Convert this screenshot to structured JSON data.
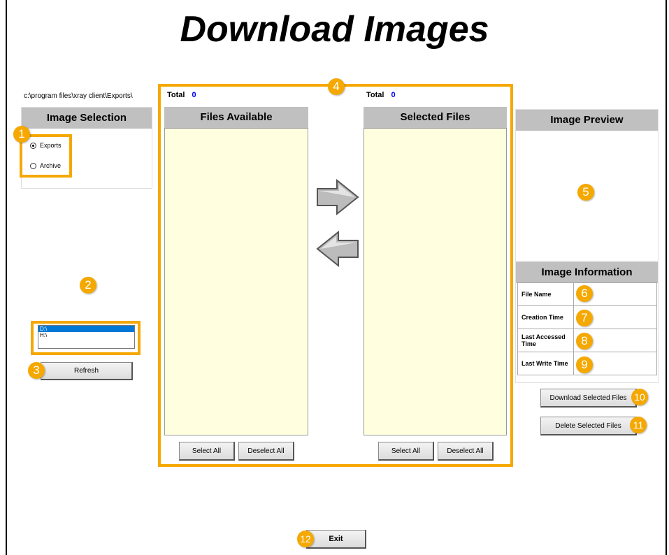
{
  "title": "Download Images",
  "path": "c:\\program files\\xray client\\Exports\\",
  "image_selection": {
    "header": "Image Selection",
    "options": [
      {
        "label": "Exports",
        "selected": true
      },
      {
        "label": "Archive",
        "selected": false
      }
    ]
  },
  "drives": {
    "items": [
      "D:\\",
      "H:\\"
    ],
    "selected": "D:\\"
  },
  "refresh_label": "Refresh",
  "files_available": {
    "total_label": "Total",
    "total_value": "0",
    "header": "Files Available",
    "select_all": "Select All",
    "deselect_all": "Deselect All"
  },
  "selected_files": {
    "total_label": "Total",
    "total_value": "0",
    "header": "Selected Files",
    "select_all": "Select All",
    "deselect_all": "Deselect All"
  },
  "image_preview": {
    "header": "Image Preview"
  },
  "image_information": {
    "header": "Image Information",
    "rows": [
      {
        "label": "File Name",
        "value": ""
      },
      {
        "label": "Creation  Time",
        "value": ""
      },
      {
        "label": "Last Accessed Time",
        "value": ""
      },
      {
        "label": "Last Write Time",
        "value": ""
      }
    ]
  },
  "download_label": "Download Selected Files",
  "delete_label": "Delete Selected Files",
  "exit_label": "Exit",
  "badges": [
    "1",
    "2",
    "3",
    "4",
    "5",
    "6",
    "7",
    "8",
    "9",
    "10",
    "11",
    "12"
  ],
  "colors": {
    "annotation": "#f5a800",
    "list_bg": "#ffffe0",
    "header_bg": "#c0c0c0",
    "total_value": "#0000ff",
    "drive_selected": "#0078d7"
  }
}
